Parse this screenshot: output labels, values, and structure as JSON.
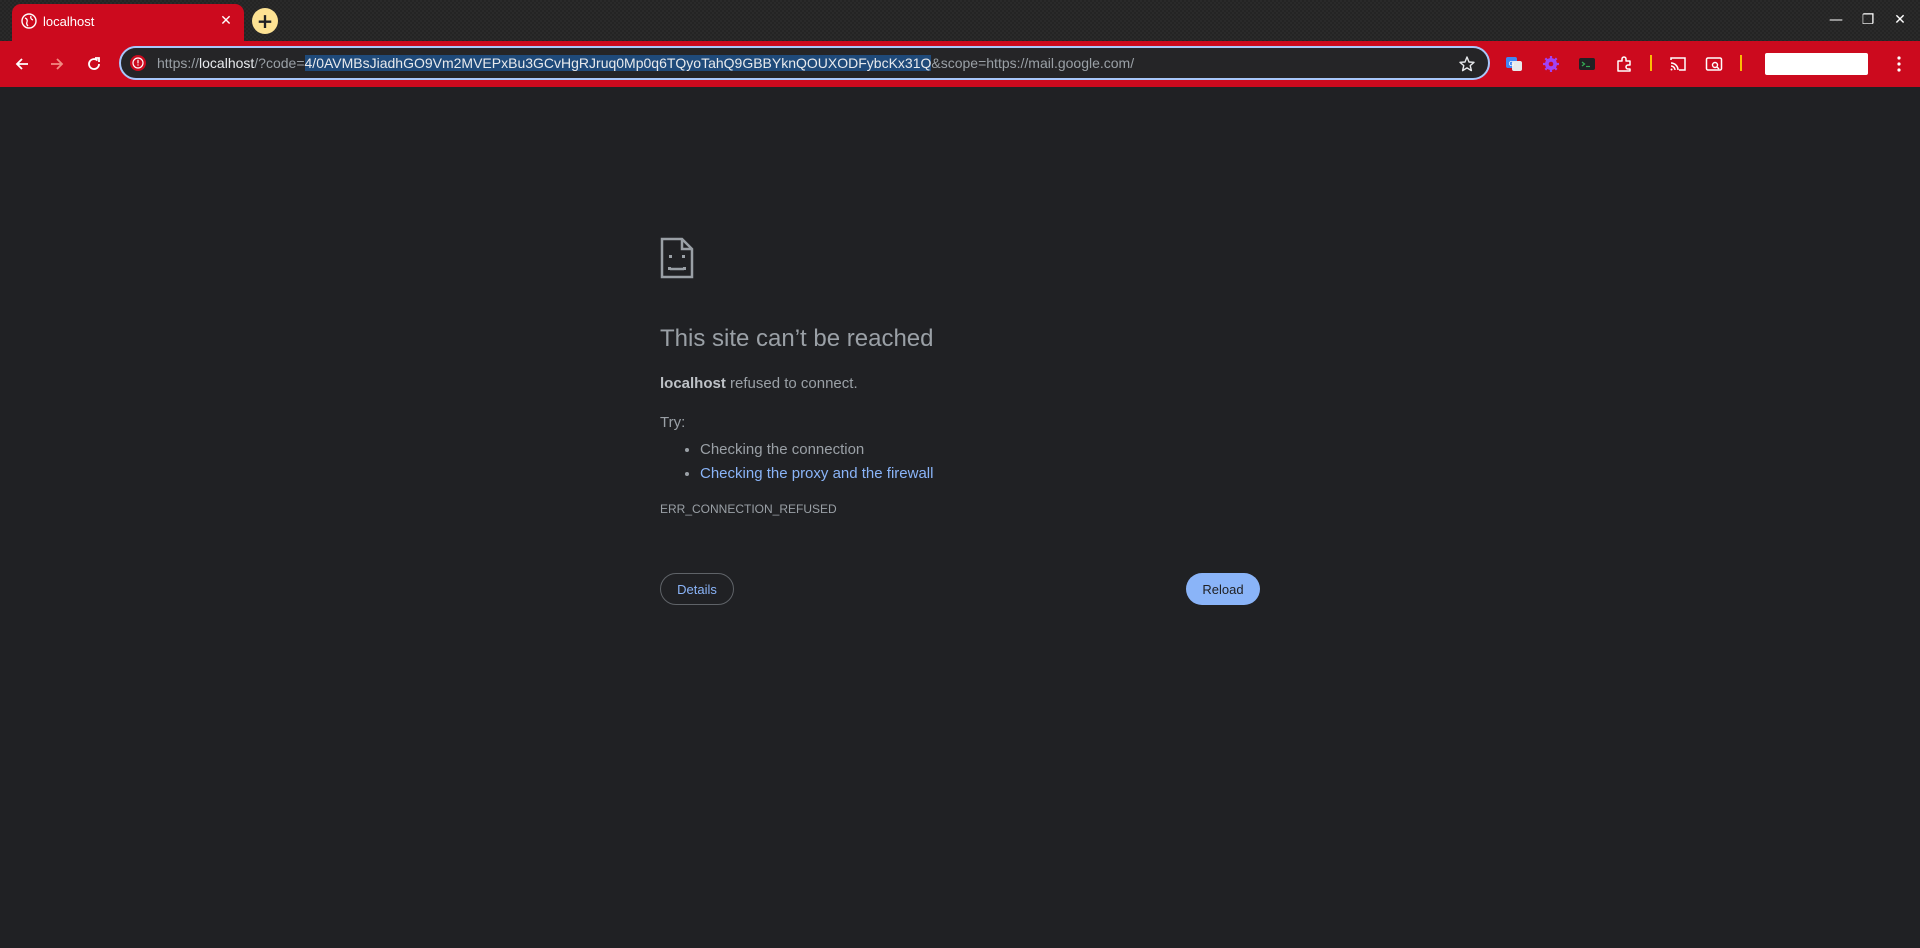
{
  "tab": {
    "title": "localhost",
    "favicon": "globe-icon",
    "close_label": "✕",
    "new_tab_label": "+"
  },
  "window": {
    "minimize": "—",
    "restore": "❐",
    "close": "✕"
  },
  "omnibox": {
    "scheme": "https://",
    "host": "localhost",
    "path_prefix": "/?code=",
    "selected": "4/0AVMBsJiadhGO9Vm2MVEPxBu3GCvHgRJruq0Mp0q6TQyoTahQ9GBBYknQOUXODFybcKx31Q",
    "suffix": "&scope=https://mail.google.com/"
  },
  "error": {
    "title": "This site can’t be reached",
    "host": "localhost",
    "description": " refused to connect.",
    "try_label": "Try:",
    "suggestions": [
      "Checking the connection",
      "Checking the proxy and the firewall"
    ],
    "code": "ERR_CONNECTION_REFUSED",
    "details_label": "Details",
    "reload_label": "Reload"
  },
  "colors": {
    "accent": "#cc0a1e",
    "page_bg": "#202124",
    "link": "#8ab4f8",
    "new_tab": "#fde293"
  }
}
